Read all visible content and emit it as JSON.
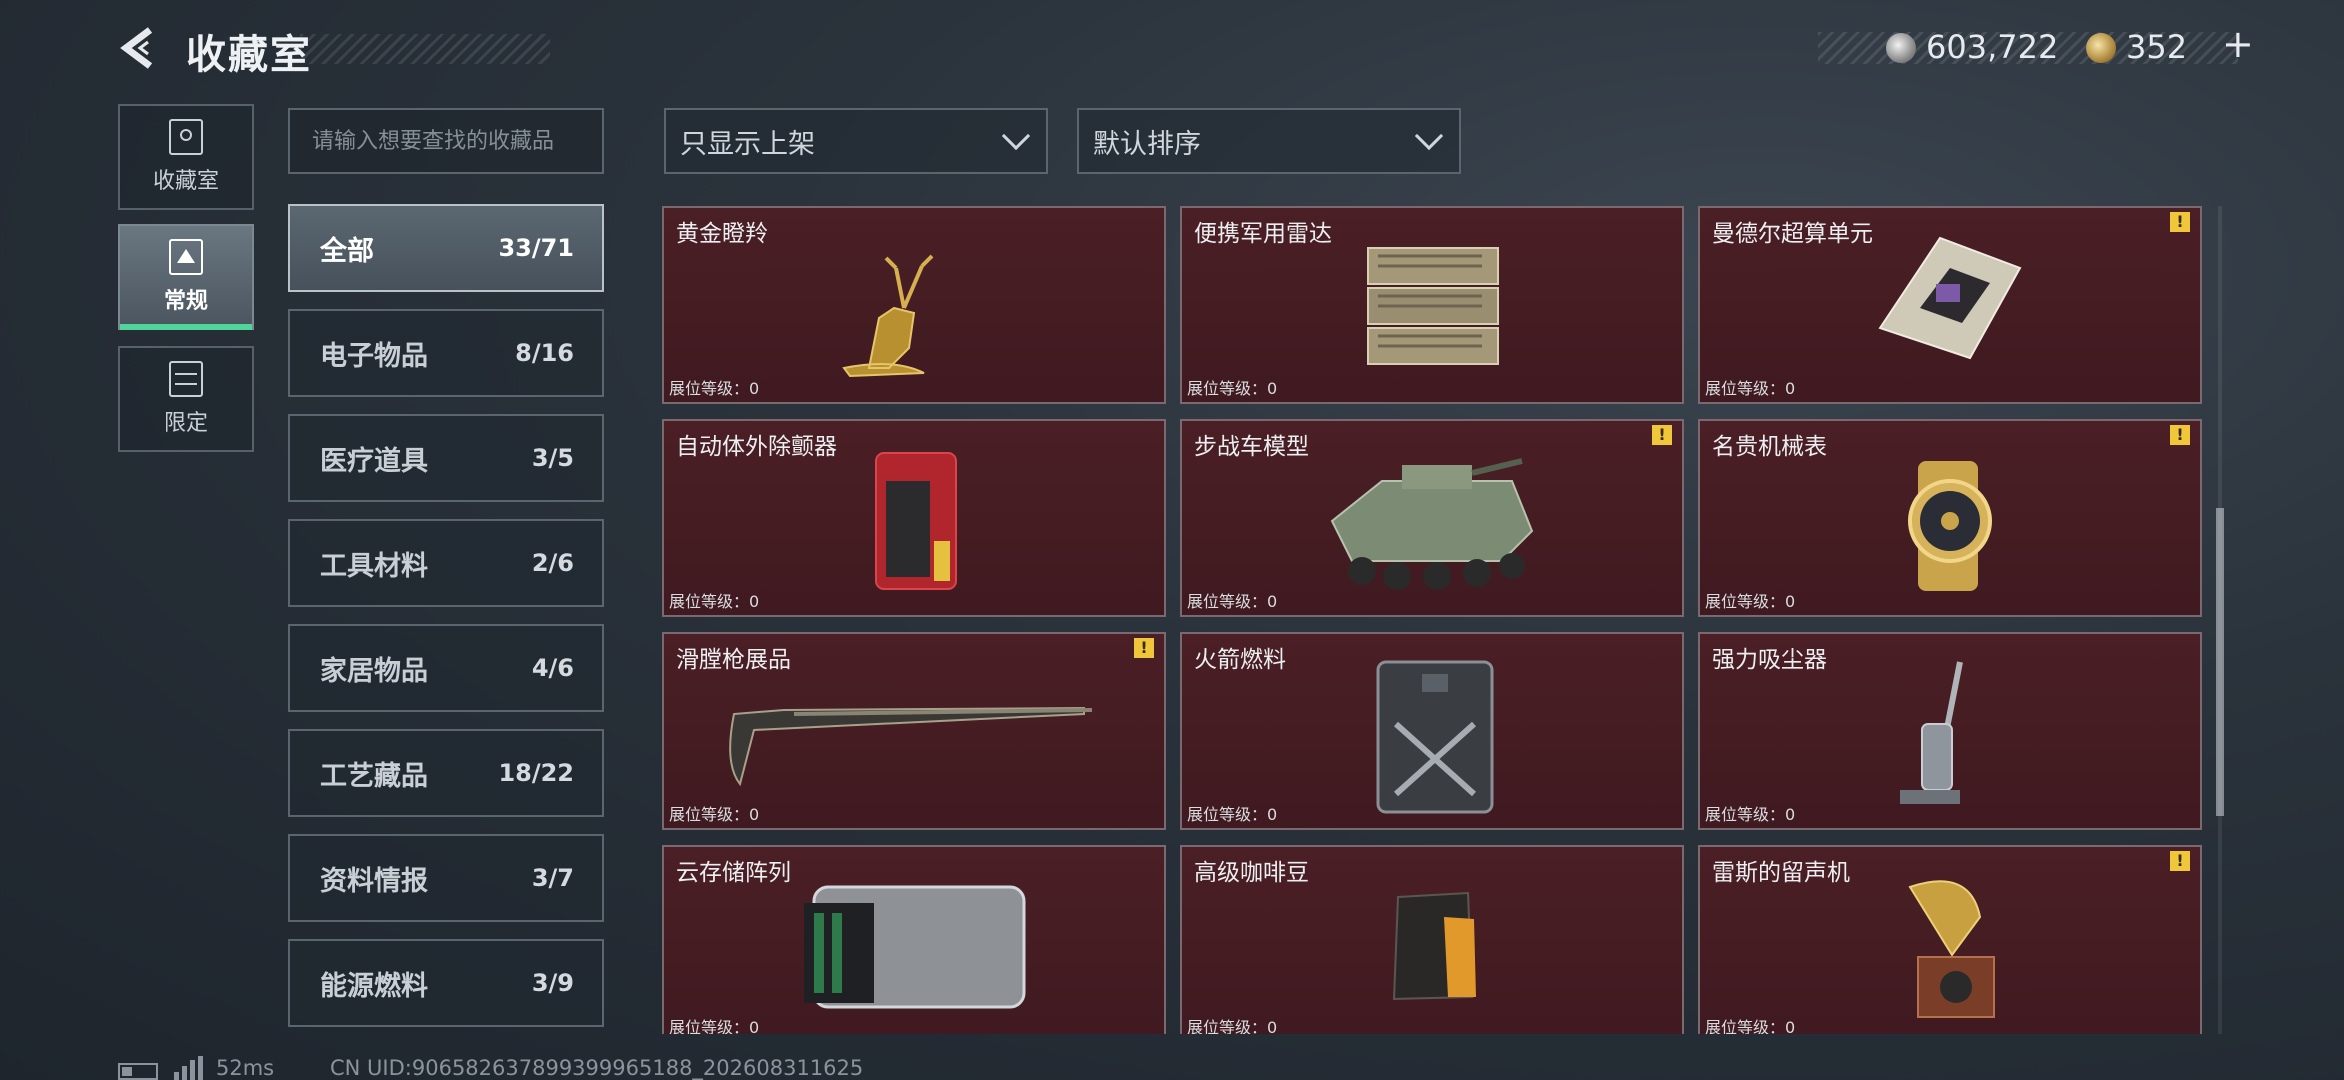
{
  "header": {
    "title": "收藏室",
    "currency_1": "603,722",
    "currency_2": "352",
    "currency_add": "+"
  },
  "nav_tabs": [
    {
      "label": "收藏室",
      "icon": "collection-room-icon",
      "active": false
    },
    {
      "label": "常规",
      "icon": "regular-display-icon",
      "active": true
    },
    {
      "label": "限定",
      "icon": "limited-display-icon",
      "active": false
    }
  ],
  "search": {
    "placeholder": "请输入想要查找的收藏品"
  },
  "categories": [
    {
      "name": "全部",
      "count": "33/71",
      "active": true
    },
    {
      "name": "电子物品",
      "count": "8/16"
    },
    {
      "name": "医疗道具",
      "count": "3/5"
    },
    {
      "name": "工具材料",
      "count": "2/6"
    },
    {
      "name": "家居物品",
      "count": "4/6"
    },
    {
      "name": "工艺藏品",
      "count": "18/22"
    },
    {
      "name": "资料情报",
      "count": "3/7"
    },
    {
      "name": "能源燃料",
      "count": "3/9"
    }
  ],
  "filters": {
    "show_filter": "只显示上架",
    "sort": "默认排序"
  },
  "level_label": "展位等级：0",
  "items": [
    {
      "name": "黄金瞪羚",
      "level": "展位等级：0",
      "warning": false,
      "icon": "golden-gazelle-icon"
    },
    {
      "name": "便携军用雷达",
      "level": "展位等级：0",
      "warning": false,
      "icon": "portable-radar-icon"
    },
    {
      "name": "曼德尔超算单元",
      "level": "展位等级：0",
      "warning": true,
      "icon": "supercomputer-unit-icon"
    },
    {
      "name": "自动体外除颤器",
      "level": "展位等级：0",
      "warning": false,
      "icon": "defibrillator-icon"
    },
    {
      "name": "步战车模型",
      "level": "展位等级：0",
      "warning": true,
      "icon": "ifv-model-icon"
    },
    {
      "name": "名贵机械表",
      "level": "展位等级：0",
      "warning": true,
      "icon": "mechanical-watch-icon"
    },
    {
      "name": "滑膛枪展品",
      "level": "展位等级：0",
      "warning": true,
      "icon": "musket-icon"
    },
    {
      "name": "火箭燃料",
      "level": "展位等级：0",
      "warning": false,
      "icon": "rocket-fuel-can-icon"
    },
    {
      "name": "强力吸尘器",
      "level": "展位等级：0",
      "warning": false,
      "icon": "vacuum-cleaner-icon"
    },
    {
      "name": "云存储阵列",
      "level": "展位等级：0",
      "warning": false,
      "icon": "cloud-storage-array-icon"
    },
    {
      "name": "高级咖啡豆",
      "level": "展位等级：0",
      "warning": false,
      "icon": "coffee-beans-icon"
    },
    {
      "name": "雷斯的留声机",
      "level": "展位等级：0",
      "warning": true,
      "icon": "gramophone-icon"
    }
  ],
  "warning_mark": "!",
  "footer": {
    "ping": "52ms",
    "uid": "CN UID:906582637899399965188_202608311625"
  },
  "colors": {
    "card_bg": "#4a1f25",
    "accent_green": "#4fd49a",
    "warning_yellow": "#f0c63a"
  }
}
